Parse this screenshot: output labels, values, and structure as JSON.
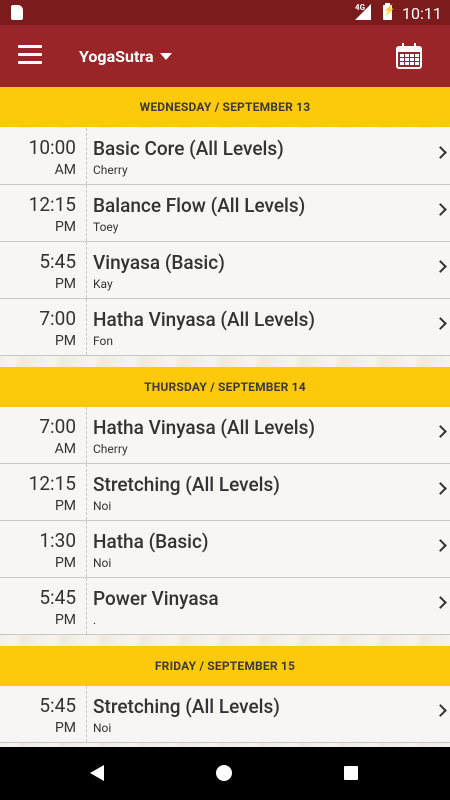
{
  "status_bar": {
    "time": "10:11",
    "network": "4G"
  },
  "app_bar": {
    "title": "YogaSutra"
  },
  "days": [
    {
      "header": "WEDNESDAY / SEPTEMBER 13",
      "classes": [
        {
          "time": "10:00",
          "ampm": "AM",
          "name": "Basic Core (All Levels)",
          "teacher": "Cherry"
        },
        {
          "time": "12:15",
          "ampm": "PM",
          "name": "Balance Flow (All Levels)",
          "teacher": "Toey"
        },
        {
          "time": "5:45",
          "ampm": "PM",
          "name": "Vinyasa (Basic)",
          "teacher": "Kay"
        },
        {
          "time": "7:00",
          "ampm": "PM",
          "name": "Hatha Vinyasa (All Levels)",
          "teacher": "Fon"
        }
      ]
    },
    {
      "header": "THURSDAY / SEPTEMBER 14",
      "classes": [
        {
          "time": "7:00",
          "ampm": "AM",
          "name": "Hatha Vinyasa (All Levels)",
          "teacher": "Cherry"
        },
        {
          "time": "12:15",
          "ampm": "PM",
          "name": "Stretching (All Levels)",
          "teacher": "Noi"
        },
        {
          "time": "1:30",
          "ampm": "PM",
          "name": "Hatha (Basic)",
          "teacher": "Noi"
        },
        {
          "time": "5:45",
          "ampm": "PM",
          "name": "Power Vinyasa",
          "teacher": "."
        }
      ]
    },
    {
      "header": "FRIDAY / SEPTEMBER 15",
      "classes": [
        {
          "time": "5:45",
          "ampm": "PM",
          "name": "Stretching (All Levels)",
          "teacher": "Noi"
        }
      ]
    }
  ],
  "colors": {
    "app_bar": "#9a2528",
    "status_bar": "#7c1b1b",
    "day_header": "#fdc90b"
  },
  "icons": {
    "menu": "hamburger-menu-icon",
    "dropdown": "caret-down-icon",
    "calendar": "calendar-icon",
    "row_arrow": "chevron-right-icon"
  }
}
